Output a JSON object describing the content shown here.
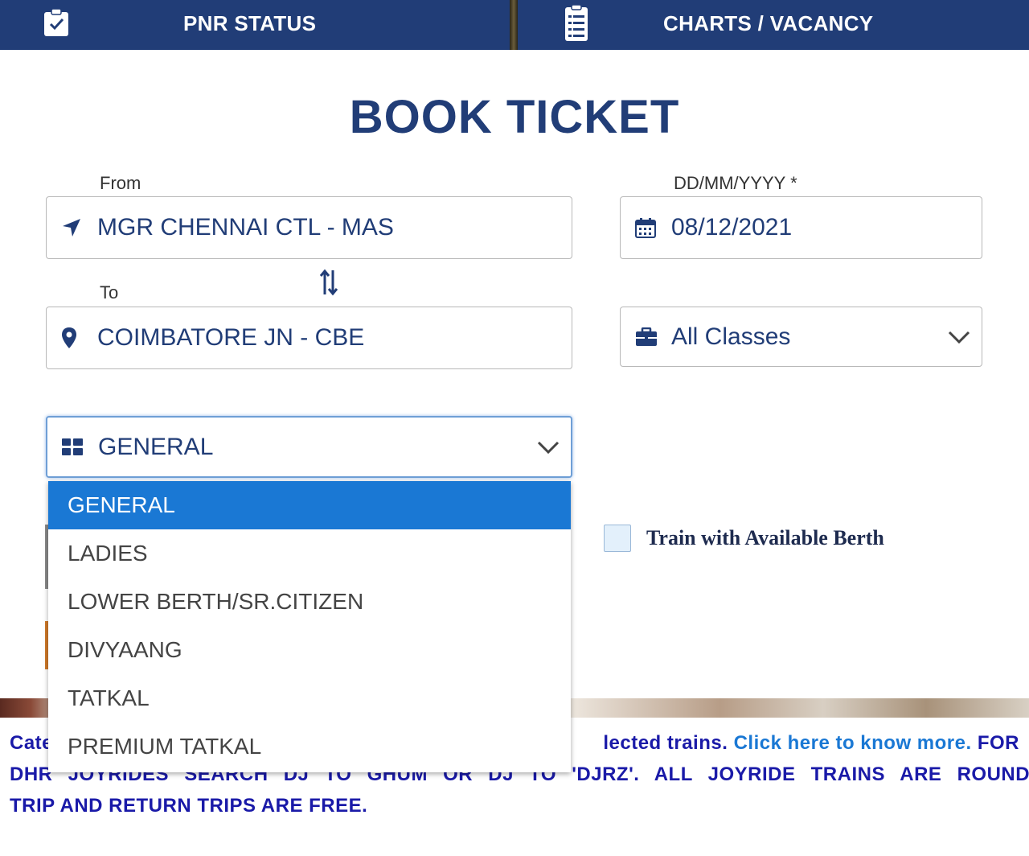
{
  "topbar": {
    "pnr_label": "PNR STATUS",
    "charts_label": "CHARTS / VACANCY",
    "pnr_icon": "clipboard-check-icon",
    "charts_icon": "document-list-icon",
    "bg_color": "#213d77"
  },
  "page": {
    "title": "BOOK TICKET"
  },
  "form": {
    "from": {
      "label": "From",
      "value": "MGR CHENNAI CTL - MAS",
      "icon": "location-arrow-icon"
    },
    "to": {
      "label": "To",
      "value": "COIMBATORE JN - CBE",
      "icon": "map-pin-icon"
    },
    "swap_icon": "swap-arrows-icon",
    "date": {
      "label": "DD/MM/YYYY *",
      "value": "08/12/2021",
      "icon": "calendar-icon"
    },
    "class": {
      "value": "All Classes",
      "icon": "briefcase-icon"
    },
    "quota": {
      "value": "GENERAL",
      "icon": "grid-icon",
      "options": [
        "GENERAL",
        "LADIES",
        "LOWER BERTH/SR.CITIZEN",
        "DIVYAANG",
        "TATKAL",
        "PREMIUM TATKAL"
      ],
      "selected_index": 0
    },
    "berth_checkbox": {
      "label": "Train with Available Berth",
      "checked": false
    }
  },
  "notice": {
    "line1_start": "Cate",
    "line1_end": "lected trains.",
    "link_text": "Click here to know more.",
    "line1_tail": "FOR",
    "line2": "DHR JOYRIDES SEARCH DJ TO GHUM OR DJ TO 'DJRZ'. ALL JOYRIDE TRAINS ARE ROUND",
    "line3": "TRIP AND RETURN TRIPS ARE FREE."
  },
  "colors": {
    "accent": "#213d77",
    "selected": "#1a78d4",
    "notice": "#1a1aa8"
  }
}
